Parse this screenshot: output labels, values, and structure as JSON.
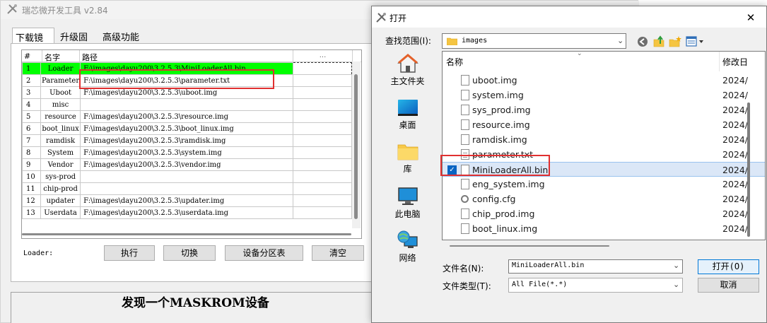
{
  "tool": {
    "title": "瑞芯微开发工具 v2.84",
    "tabs": [
      "下载镜像",
      "升级固件",
      "高级功能"
    ],
    "table": {
      "headers": [
        "#",
        "名字",
        "路径",
        "..."
      ],
      "rows": [
        {
          "num": "1",
          "name": "Loader",
          "path": "F:\\images\\dayu200\\3.2.5.3\\MiniLoaderAll.bin",
          "selected": true
        },
        {
          "num": "2",
          "name": "Parameter",
          "path": "F:\\images\\dayu200\\3.2.5.3\\parameter.txt"
        },
        {
          "num": "3",
          "name": "Uboot",
          "path": "F:\\images\\dayu200\\3.2.5.3\\uboot.img"
        },
        {
          "num": "4",
          "name": "misc",
          "path": ""
        },
        {
          "num": "5",
          "name": "resource",
          "path": "F:\\images\\dayu200\\3.2.5.3\\resource.img"
        },
        {
          "num": "6",
          "name": "boot_linux",
          "path": "F:\\images\\dayu200\\3.2.5.3\\boot_linux.img"
        },
        {
          "num": "7",
          "name": "ramdisk",
          "path": "F:\\images\\dayu200\\3.2.5.3\\ramdisk.img"
        },
        {
          "num": "8",
          "name": "System",
          "path": "F:\\images\\dayu200\\3.2.5.3\\system.img"
        },
        {
          "num": "9",
          "name": "Vendor",
          "path": "F:\\images\\dayu200\\3.2.5.3\\vendor.img"
        },
        {
          "num": "10",
          "name": "sys-prod",
          "path": ""
        },
        {
          "num": "11",
          "name": "chip-prod",
          "path": ""
        },
        {
          "num": "12",
          "name": "updater",
          "path": "F:\\images\\dayu200\\3.2.5.3\\updater.img"
        },
        {
          "num": "13",
          "name": "Userdata",
          "path": "F:\\images\\dayu200\\3.2.5.3\\userdata.img"
        }
      ]
    },
    "loader_label": "Loader:",
    "buttons": {
      "run": "执行",
      "switch": "切换",
      "partition": "设备分区表",
      "clear": "清空"
    },
    "status": "发现一个MASKROM设备"
  },
  "dialog": {
    "title": "打开",
    "close_glyph": "✕",
    "look_in_label": "查找范围(I):",
    "look_in_value": "images",
    "places": [
      "主文件夹",
      "桌面",
      "库",
      "此电脑",
      "网络"
    ],
    "list_header_name": "名称",
    "list_header_date": "修改日",
    "files": [
      {
        "name": "uboot.img",
        "date": "2024/",
        "icon": "file-icon"
      },
      {
        "name": "system.img",
        "date": "2024/",
        "icon": "file-icon"
      },
      {
        "name": "sys_prod.img",
        "date": "2024/",
        "icon": "file-icon"
      },
      {
        "name": "resource.img",
        "date": "2024/",
        "icon": "file-icon"
      },
      {
        "name": "ramdisk.img",
        "date": "2024/",
        "icon": "file-icon"
      },
      {
        "name": "parameter.txt",
        "date": "2024/",
        "icon": "text-file-icon"
      },
      {
        "name": "MiniLoaderAll.bin",
        "date": "2024/",
        "icon": "file-icon",
        "selected": true
      },
      {
        "name": "eng_system.img",
        "date": "2024/",
        "icon": "file-icon"
      },
      {
        "name": "config.cfg",
        "date": "2024/",
        "icon": "config-file-icon"
      },
      {
        "name": "chip_prod.img",
        "date": "2024/",
        "icon": "file-icon"
      },
      {
        "name": "boot_linux.img",
        "date": "2024/",
        "icon": "file-icon"
      }
    ],
    "filename_label": "文件名(N):",
    "filename_value": "MiniLoaderAll.bin",
    "filetype_label": "文件类型(T):",
    "filetype_value": "All File(*.*)",
    "open_label": "打开(O)",
    "cancel_label": "取消"
  }
}
